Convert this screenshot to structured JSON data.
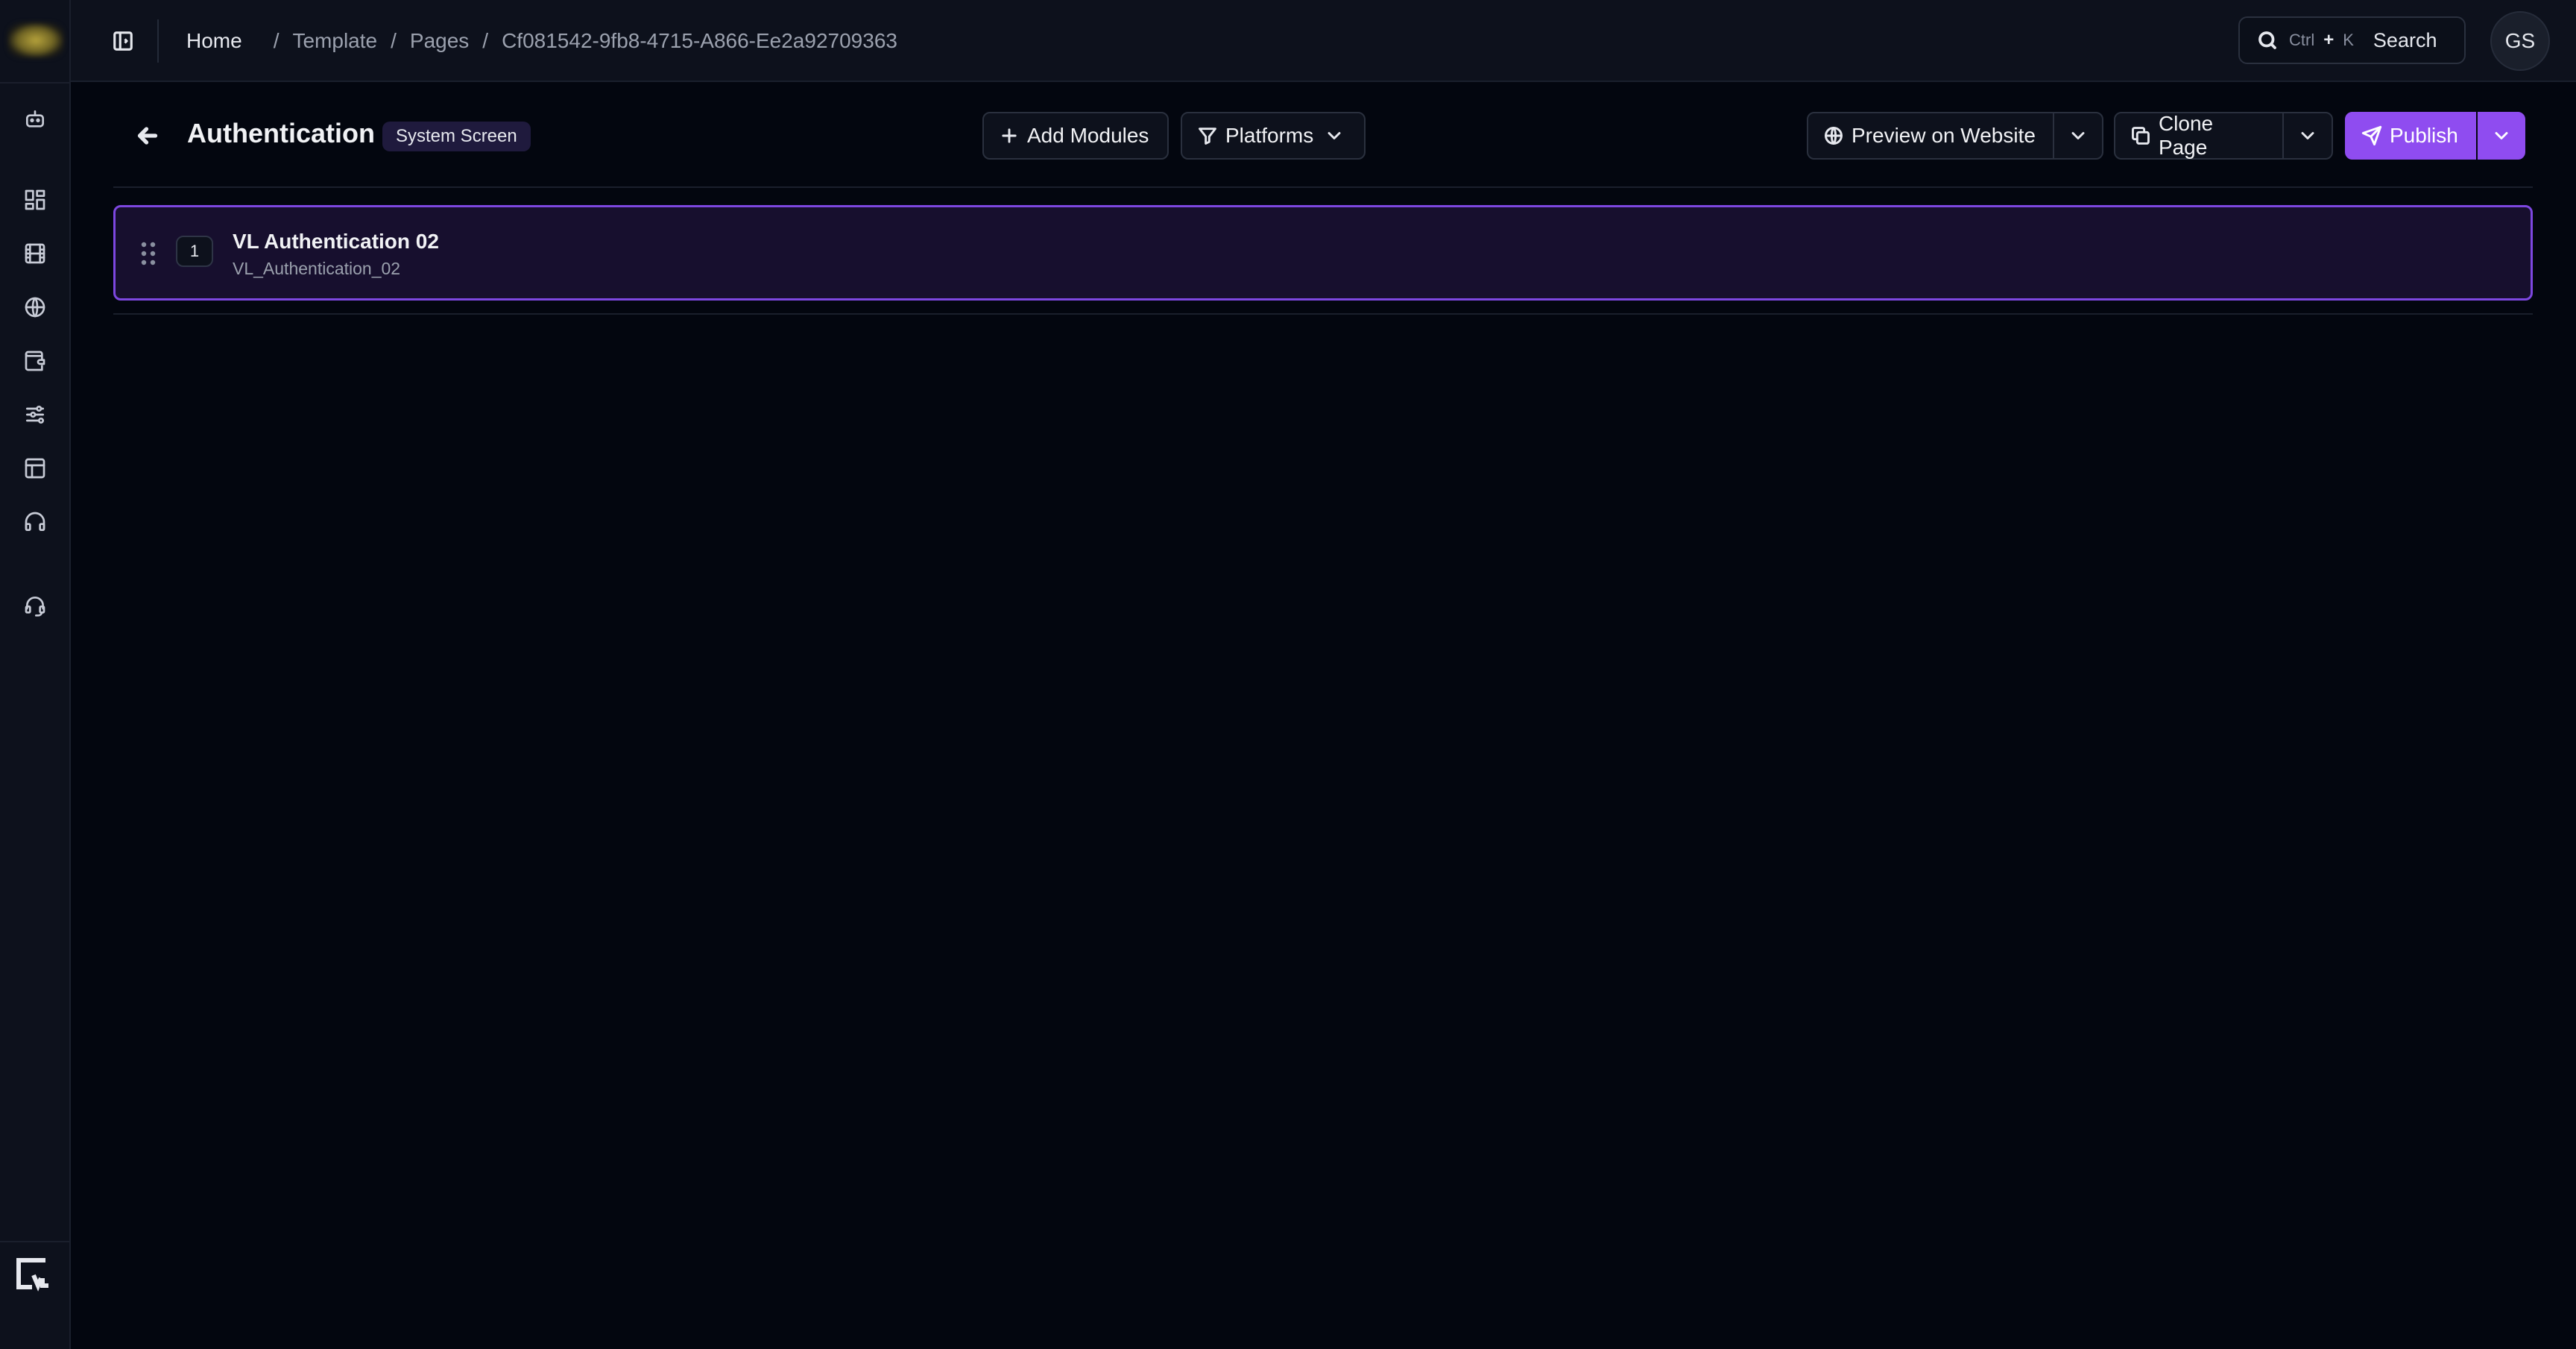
{
  "breadcrumb": {
    "home": "Home",
    "items": [
      "Template",
      "Pages",
      "Cf081542-9fb8-4715-A866-Ee2a92709363"
    ],
    "separator": "/"
  },
  "search": {
    "shortcut_key1": "Ctrl",
    "shortcut_plus": "+",
    "shortcut_key2": "K",
    "label": "Search"
  },
  "user": {
    "initials": "GS"
  },
  "page": {
    "title": "Authentication",
    "badge": "System Screen"
  },
  "toolbar": {
    "add_modules": "Add Modules",
    "platforms": "Platforms",
    "preview": "Preview on Website",
    "clone": "Clone Page",
    "publish": "Publish"
  },
  "modules": [
    {
      "index": "1",
      "title": "VL Authentication 02",
      "subtitle": "VL_Authentication_02"
    }
  ],
  "sidebar": {
    "icons": [
      "bot-icon",
      "dashboard-icon",
      "film-icon",
      "globe-icon",
      "wallet-icon",
      "sliders-icon",
      "layout-icon",
      "headphones-icon",
      "headset-icon"
    ]
  },
  "colors": {
    "accent": "#8f4cf0",
    "background": "#03060f",
    "surface": "#0d111c",
    "card": "#170f2e"
  }
}
